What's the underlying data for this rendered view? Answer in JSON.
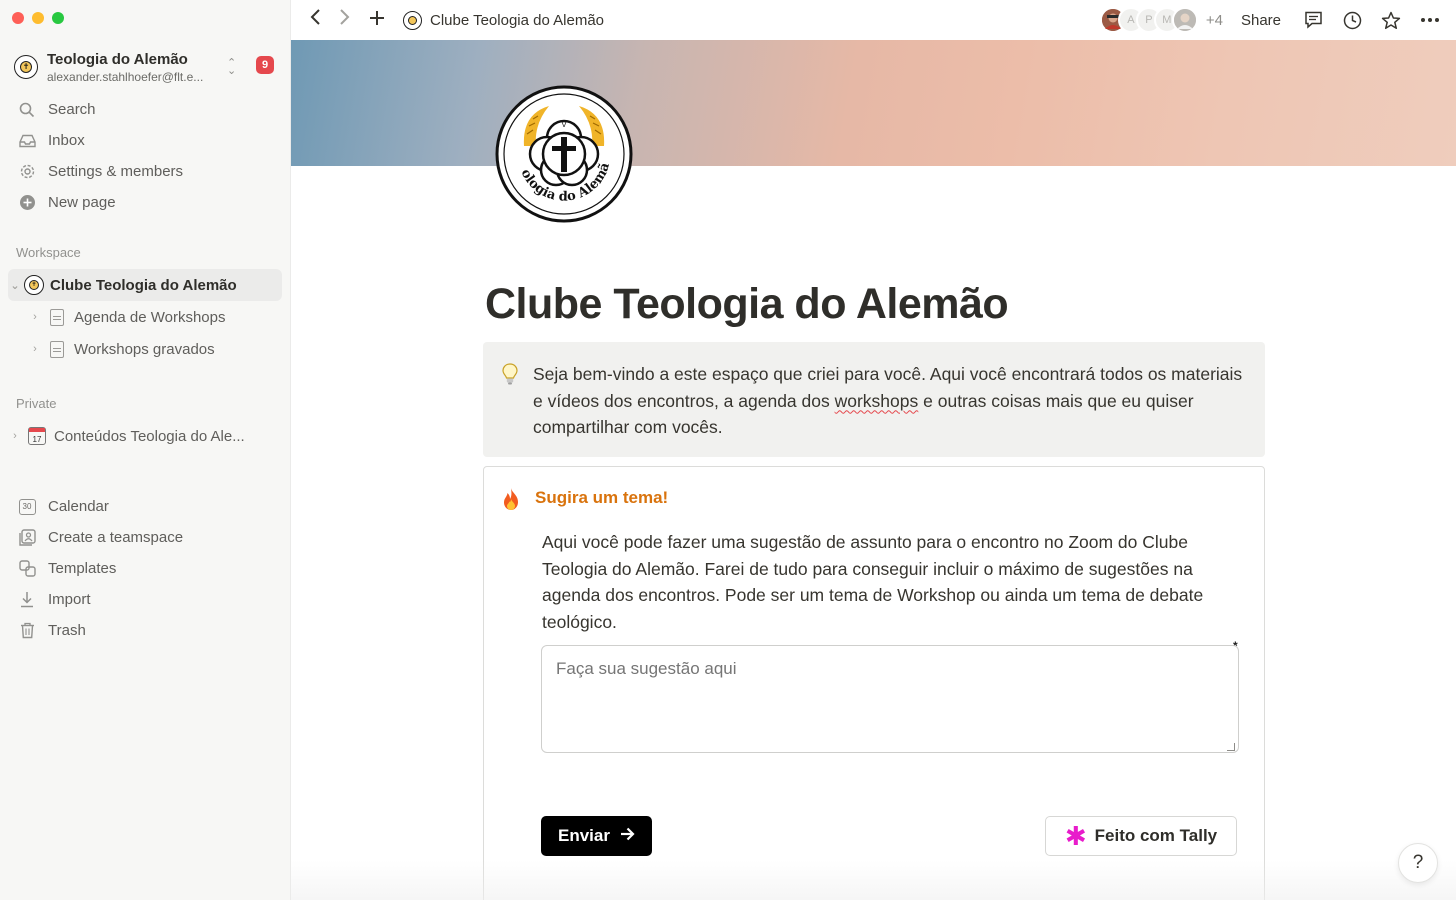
{
  "sidebar": {
    "workspace": {
      "name": "Teologia do Alemão",
      "email": "alexander.stahlhoefer@flt.e...",
      "badge": "9"
    },
    "nav": [
      {
        "label": "Search",
        "icon": "search-icon"
      },
      {
        "label": "Inbox",
        "icon": "inbox-icon"
      },
      {
        "label": "Settings & members",
        "icon": "gear-icon"
      },
      {
        "label": "New page",
        "icon": "plus-circle-icon"
      }
    ],
    "workspace_section": "Workspace",
    "workspace_tree": [
      {
        "label": "Clube Teologia do Alemão",
        "active": true
      },
      {
        "label": "Agenda de Workshops"
      },
      {
        "label": "Workshops gravados"
      }
    ],
    "private_section": "Private",
    "private_tree": [
      {
        "label": "Conteúdos Teologia do Ale...",
        "icon_text": "17"
      }
    ],
    "bottom_nav": [
      {
        "label": "Calendar",
        "icon": "calendar-icon",
        "icon_text": "30"
      },
      {
        "label": "Create a teamspace",
        "icon": "teamspace-icon"
      },
      {
        "label": "Templates",
        "icon": "templates-icon"
      },
      {
        "label": "Import",
        "icon": "import-icon"
      },
      {
        "label": "Trash",
        "icon": "trash-icon"
      }
    ]
  },
  "topbar": {
    "breadcrumb": "Clube Teologia do Alemão",
    "avatars": [
      "A",
      "P",
      "M"
    ],
    "more_count": "+4",
    "share": "Share"
  },
  "page": {
    "title": "Clube Teologia do Alemão",
    "logo_text": "Teologia do Alemão",
    "callout": {
      "before": "Seja bem-vindo a este espaço que criei para você. Aqui você encontrará todos os materiais e vídeos dos encontros, a agenda dos ",
      "underlined": "workshops",
      "after": " e outras coisas mais que eu quiser compartilhar com vocês."
    },
    "form": {
      "title": "Sugira um tema!",
      "description": "Aqui você pode fazer uma sugestão de assunto para o encontro no Zoom do Clube Teologia do Alemão. Farei de tudo para conseguir incluir o máximo de sugestões na agenda dos encontros. Pode ser um tema de Workshop ou ainda um tema de debate teológico.",
      "placeholder": "Faça sua sugestão aqui",
      "required_mark": "*",
      "submit": "Enviar",
      "tally": "Feito com Tally"
    }
  },
  "help": "?",
  "colors": {
    "accent_orange": "#d9730d",
    "badge_red": "#e5484d",
    "tally_pink": "#e81ccb"
  }
}
